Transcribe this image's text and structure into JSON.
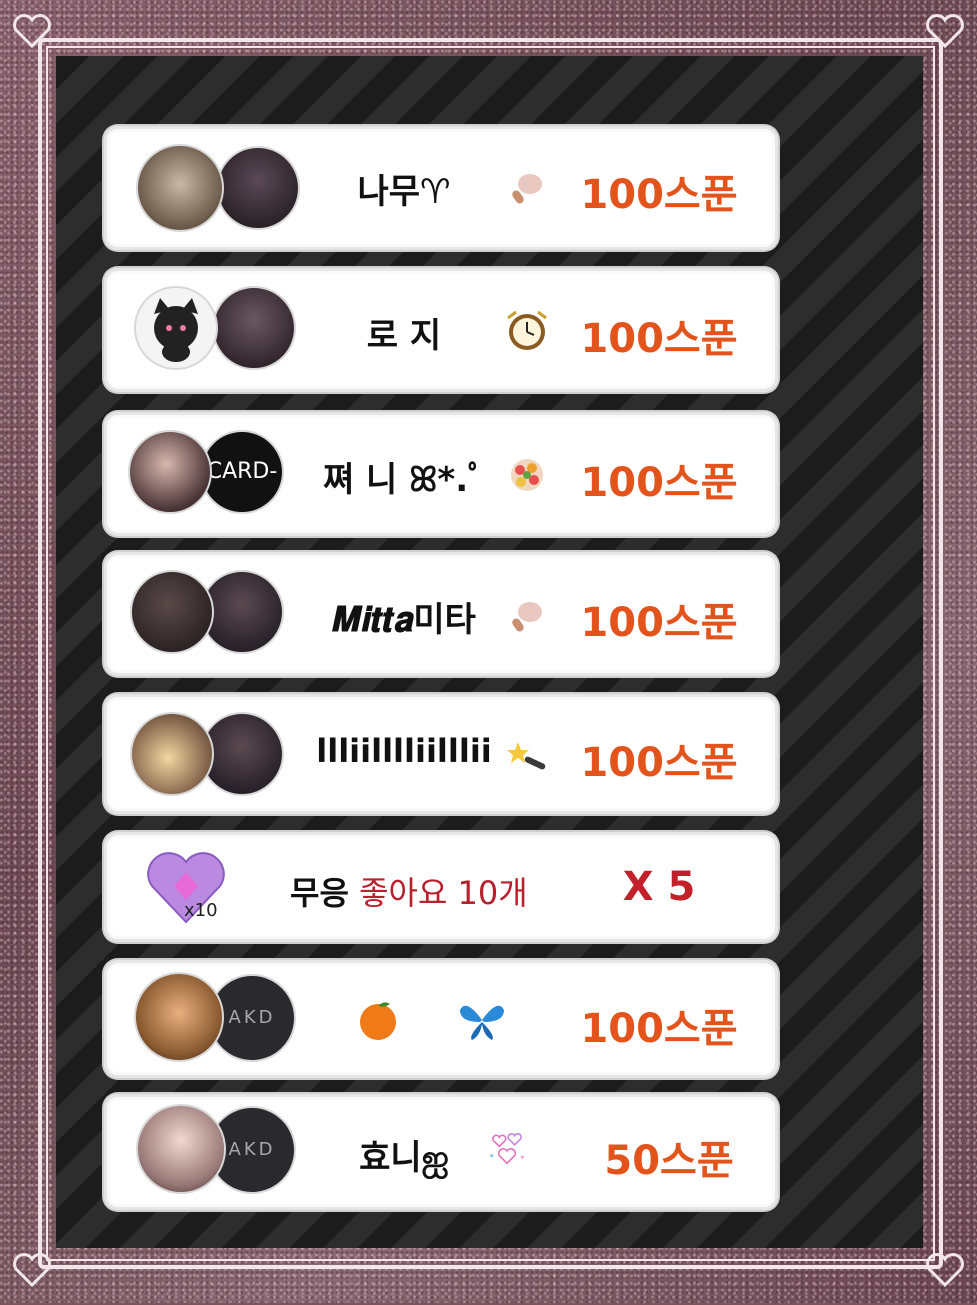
{
  "rows": [
    {
      "name": "나무♈︎",
      "gift_icon": "drumstick-icon",
      "amount": "100스푼"
    },
    {
      "name": "로 지",
      "gift_icon": "clock-icon",
      "amount": "100스푼"
    },
    {
      "name": "쪄 니 ꕤ*.ﾟ",
      "gift_icon": "bouquet-icon",
      "amount": "100스푼"
    },
    {
      "name": "𝑴𝒊𝒕𝒕𝒂미타",
      "gift_icon": "drumstick-icon",
      "amount": "100스푼"
    },
    {
      "name": "llliilllliilllii",
      "gift_icon": "magic-wand-icon",
      "amount": "100스푼"
    },
    {
      "name": "무응",
      "like_text": "좋아요 10개",
      "badge": "x10",
      "multiplier": "X 5",
      "gift_icon": "crystal-heart-icon"
    },
    {
      "name_icon_1": "orange-icon",
      "name_icon_2": "butterfly-icon",
      "amount": "100스푼"
    },
    {
      "name": "효니ஐ",
      "gift_icon": "hearts-icon",
      "amount": "50스푼"
    }
  ],
  "avatar_b_texts": [
    "",
    "",
    "CARD-",
    "",
    "",
    "",
    "AKD",
    "AKD"
  ],
  "colors": {
    "amount": "#e2541c",
    "like": "#b8202c",
    "multiplier": "#c2202a"
  }
}
